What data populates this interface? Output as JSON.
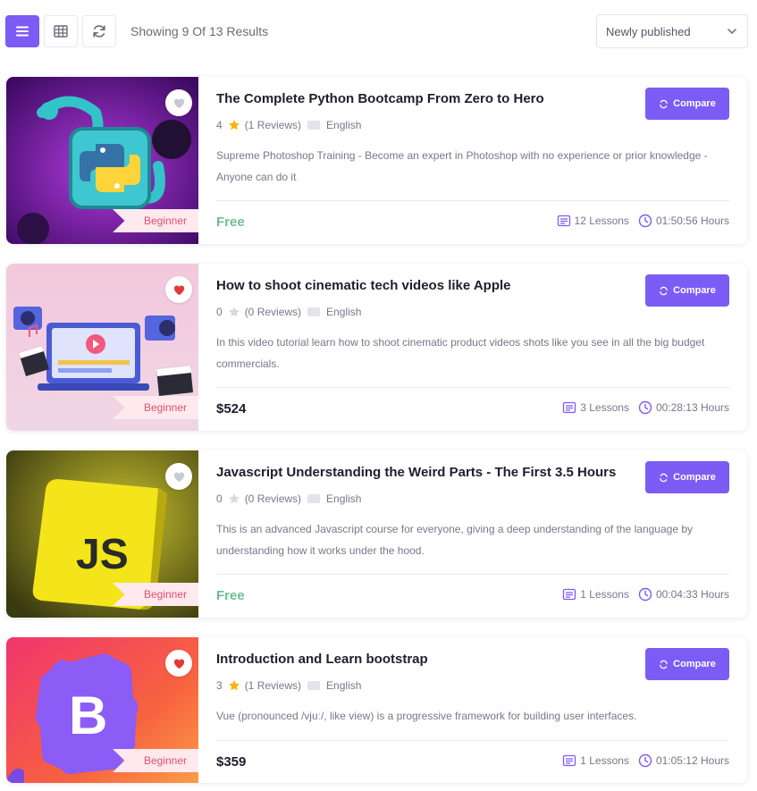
{
  "toolbar": {
    "result_text": "Showing 9 Of 13 Results",
    "sort_value": "Newly published",
    "list_view_icon": "list-icon",
    "grid_view_icon": "grid-icon",
    "refresh_icon": "refresh-icon"
  },
  "colors": {
    "accent": "#7b5cf5",
    "free_price": "#6cc18c",
    "level_badge_bg": "#fde9ee",
    "level_badge_text": "#e0506e",
    "star_filled": "#f5b50a",
    "heart_filled": "#e53935"
  },
  "courses": [
    {
      "title": "The Complete Python Bootcamp From Zero to Hero",
      "rating": "4",
      "star_filled": true,
      "reviews": "(1 Reviews)",
      "language": "English",
      "description": "Supreme Photoshop Training - Become an expert in Photoshop with no experience or prior knowledge - Anyone can do it",
      "price": "Free",
      "lessons": "12 Lessons",
      "duration": "01:50:56 Hours",
      "level": "Beginner",
      "favorited": false,
      "compare_label": "Compare",
      "thumbnail": "python-logo"
    },
    {
      "title": "How to shoot cinematic tech videos like Apple",
      "rating": "0",
      "star_filled": false,
      "reviews": "(0 Reviews)",
      "language": "English",
      "description": "In this video tutorial learn how to shoot cinematic product videos shots like you see in all the big budget commercials.",
      "price": "$524",
      "lessons": "3 Lessons",
      "duration": "00:28:13 Hours",
      "level": "Beginner",
      "favorited": true,
      "compare_label": "Compare",
      "thumbnail": "video-editing"
    },
    {
      "title": "Javascript Understanding the Weird Parts - The First 3.5 Hours",
      "rating": "0",
      "star_filled": false,
      "reviews": "(0 Reviews)",
      "language": "English",
      "description": "This is an advanced Javascript course for everyone, giving a deep understanding of the language by understanding how it works under the hood.",
      "price": "Free",
      "lessons": "1 Lessons",
      "duration": "00:04:33 Hours",
      "level": "Beginner",
      "favorited": false,
      "compare_label": "Compare",
      "thumbnail": "js-logo",
      "thumbnail_text": "JS"
    },
    {
      "title": "Introduction and Learn bootstrap",
      "rating": "3",
      "star_filled": true,
      "reviews": "(1 Reviews)",
      "language": "English",
      "description": "Vue (pronounced /vjuː/, like view) is a progressive framework for building user interfaces.",
      "price": "$359",
      "lessons": "1 Lessons",
      "duration": "01:05:12 Hours",
      "level": "Beginner",
      "favorited": true,
      "compare_label": "Compare",
      "thumbnail": "bootstrap-logo",
      "thumbnail_text": "B"
    }
  ]
}
